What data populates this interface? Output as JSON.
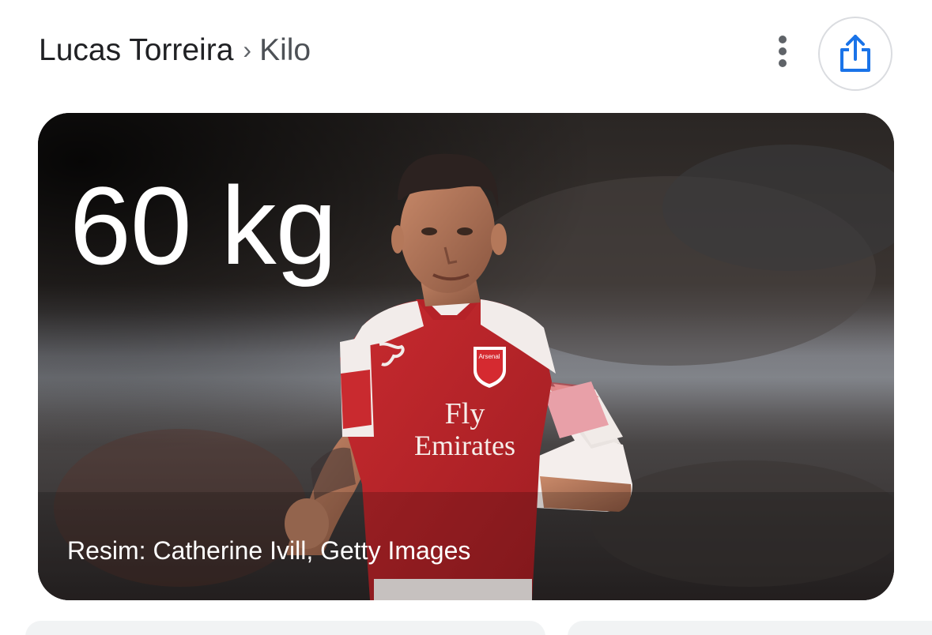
{
  "header": {
    "breadcrumb_entity": "Lucas Torreira",
    "breadcrumb_separator": "›",
    "breadcrumb_attribute": "Kilo",
    "menu_icon": "more-vert-icon",
    "share_icon": "share-icon"
  },
  "card": {
    "value": "60 kg",
    "credit": "Resim: Catherine Ivill, Getty Images",
    "shirt_sponsor_line1": "Fly",
    "shirt_sponsor_line2": "Emirates",
    "badge_text": "Arsenal"
  },
  "colors": {
    "accent": "#1a73e8",
    "text_primary": "#202124",
    "text_secondary": "#5f6368",
    "shirt_red": "#d42a2e"
  }
}
